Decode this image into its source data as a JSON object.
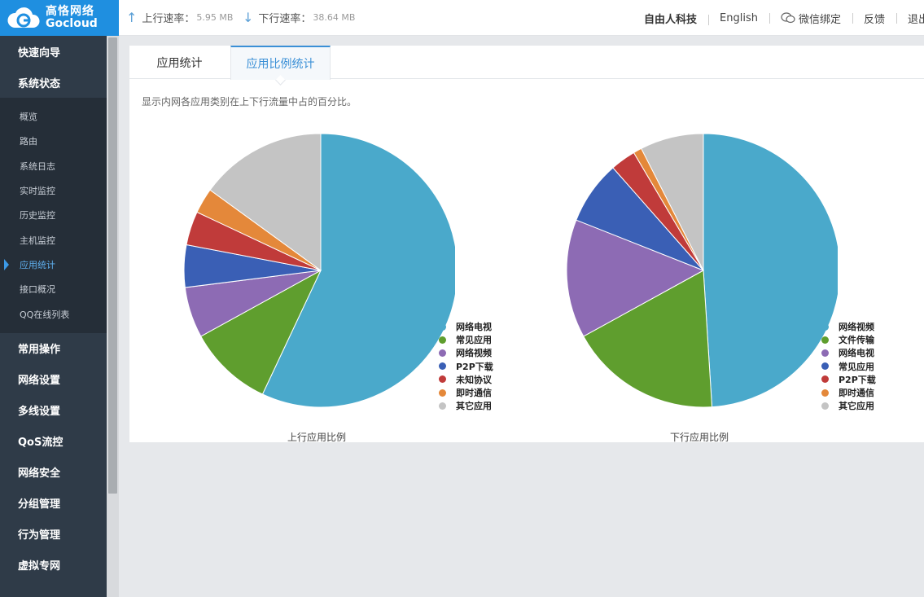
{
  "header": {
    "logo_cn": "高恪网络",
    "logo_en": "Gocloud",
    "upload_label": "上行速率：",
    "upload_value": "5.95 MB",
    "download_label": "下行速率：",
    "download_value": "38.64 MB",
    "nav": [
      "自由人科技",
      "English",
      "微信绑定",
      "反馈",
      "退出"
    ]
  },
  "sidebar": {
    "groups_top": [
      "快速向导",
      "系统状态"
    ],
    "sub_items": [
      "概览",
      "路由",
      "系统日志",
      "实时监控",
      "历史监控",
      "主机监控",
      "应用统计",
      "接口概况",
      "QQ在线列表"
    ],
    "active_index": 6,
    "groups_bottom": [
      "常用操作",
      "网络设置",
      "多线设置",
      "QoS流控",
      "网络安全",
      "分组管理",
      "行为管理",
      "虚拟专网"
    ]
  },
  "tabs": [
    "应用统计",
    "应用比例统计"
  ],
  "description": "显示内网各应用类别在上下行流量中占的百分比。",
  "colors": {
    "teal": "#4aa9cb",
    "green": "#5f9e2e",
    "purple": "#8d6bb4",
    "blue": "#3a5fb5",
    "red": "#c03b3a",
    "orange": "#e4883a",
    "gray": "#c4c4c4"
  },
  "chart_data": [
    {
      "type": "pie",
      "title": "上行应用比例",
      "slices": [
        {
          "name": "网络电视",
          "value": 57.0,
          "color": "#4aa9cb"
        },
        {
          "name": "常见应用",
          "value": 10.0,
          "color": "#5f9e2e"
        },
        {
          "name": "网络视频",
          "value": 6.0,
          "color": "#8d6bb4"
        },
        {
          "name": "P2P下载",
          "value": 5.0,
          "color": "#3a5fb5"
        },
        {
          "name": "未知协议",
          "value": 4.0,
          "color": "#c03b3a"
        },
        {
          "name": "即时通信",
          "value": 3.0,
          "color": "#e4883a"
        },
        {
          "name": "其它应用",
          "value": 15.0,
          "color": "#c4c4c4"
        }
      ],
      "legend": "right"
    },
    {
      "type": "pie",
      "title": "下行应用比例",
      "slices": [
        {
          "name": "网络视频",
          "value": 49.0,
          "color": "#4aa9cb"
        },
        {
          "name": "文件传输",
          "value": 18.0,
          "color": "#5f9e2e"
        },
        {
          "name": "网络电视",
          "value": 14.0,
          "color": "#8d6bb4"
        },
        {
          "name": "常见应用",
          "value": 7.5,
          "color": "#3a5fb5"
        },
        {
          "name": "P2P下载",
          "value": 3.0,
          "color": "#c03b3a"
        },
        {
          "name": "即时通信",
          "value": 1.0,
          "color": "#e4883a"
        },
        {
          "name": "其它应用",
          "value": 7.5,
          "color": "#c4c4c4"
        }
      ],
      "legend": "right"
    }
  ]
}
